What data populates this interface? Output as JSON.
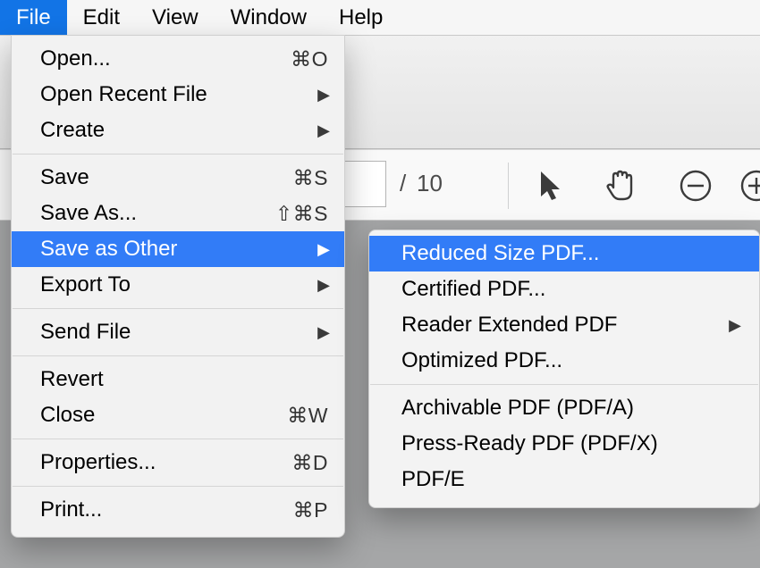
{
  "menubar": {
    "items": [
      {
        "label": "File",
        "active": true
      },
      {
        "label": "Edit",
        "active": false
      },
      {
        "label": "View",
        "active": false
      },
      {
        "label": "Window",
        "active": false
      },
      {
        "label": "Help",
        "active": false
      }
    ]
  },
  "toolbar": {
    "page_total": "10",
    "slash": "/"
  },
  "file_menu": {
    "open": {
      "label": "Open...",
      "accel": "⌘O"
    },
    "open_recent": {
      "label": "Open Recent File"
    },
    "create": {
      "label": "Create"
    },
    "save": {
      "label": "Save",
      "accel": "⌘S"
    },
    "save_as": {
      "label": "Save As...",
      "accel": "⇧⌘S"
    },
    "save_as_other": {
      "label": "Save as Other"
    },
    "export_to": {
      "label": "Export To"
    },
    "send_file": {
      "label": "Send File"
    },
    "revert": {
      "label": "Revert"
    },
    "close": {
      "label": "Close",
      "accel": "⌘W"
    },
    "properties": {
      "label": "Properties...",
      "accel": "⌘D"
    },
    "print": {
      "label": "Print...",
      "accel": "⌘P"
    }
  },
  "save_as_other_submenu": {
    "reduced": {
      "label": "Reduced Size PDF..."
    },
    "certified": {
      "label": "Certified PDF..."
    },
    "reader_ext": {
      "label": "Reader Extended PDF"
    },
    "optimized": {
      "label": "Optimized PDF..."
    },
    "pdfa": {
      "label": "Archivable PDF (PDF/A)"
    },
    "pdfx": {
      "label": "Press-Ready PDF (PDF/X)"
    },
    "pdfe": {
      "label": "PDF/E"
    }
  }
}
